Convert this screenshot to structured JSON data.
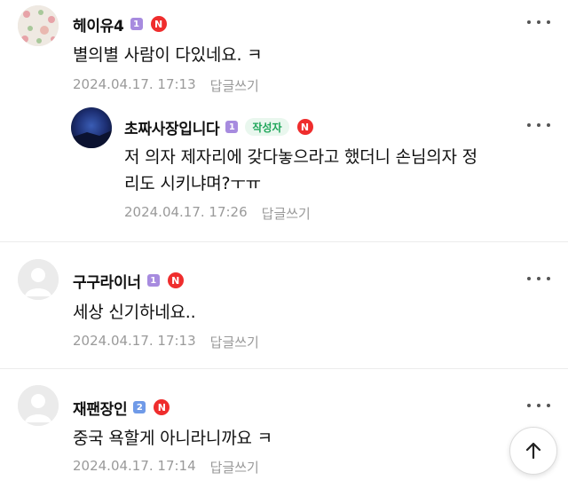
{
  "comments": [
    {
      "author": "헤이유4",
      "level": "1",
      "n_badge": "N",
      "text": "별의별 사람이 다있네요. ㅋ",
      "date": "2024.04.17. 17:13",
      "reply_label": "답글쓰기"
    },
    {
      "author": "초짜사장입니다",
      "level": "1",
      "author_tag": "작성자",
      "n_badge": "N",
      "text_line1": "저 의자 제자리에 갖다놓으라고 했더니 손님의자 정",
      "text_line2": "리도 시키냐며?ㅜㅠ",
      "date": "2024.04.17. 17:26",
      "reply_label": "답글쓰기"
    },
    {
      "author": "구구라이너",
      "level": "1",
      "n_badge": "N",
      "text": "세상 신기하네요..",
      "date": "2024.04.17. 17:13",
      "reply_label": "답글쓰기"
    },
    {
      "author": "재팬장인",
      "level": "2",
      "n_badge": "N",
      "text": "중국 욕할게 아니라니까요 ㅋ",
      "date": "2024.04.17. 17:14",
      "reply_label": "답글쓰기"
    }
  ],
  "icons": {
    "more": "more-vertical-dots-icon",
    "scroll_top": "arrow-up-icon"
  }
}
